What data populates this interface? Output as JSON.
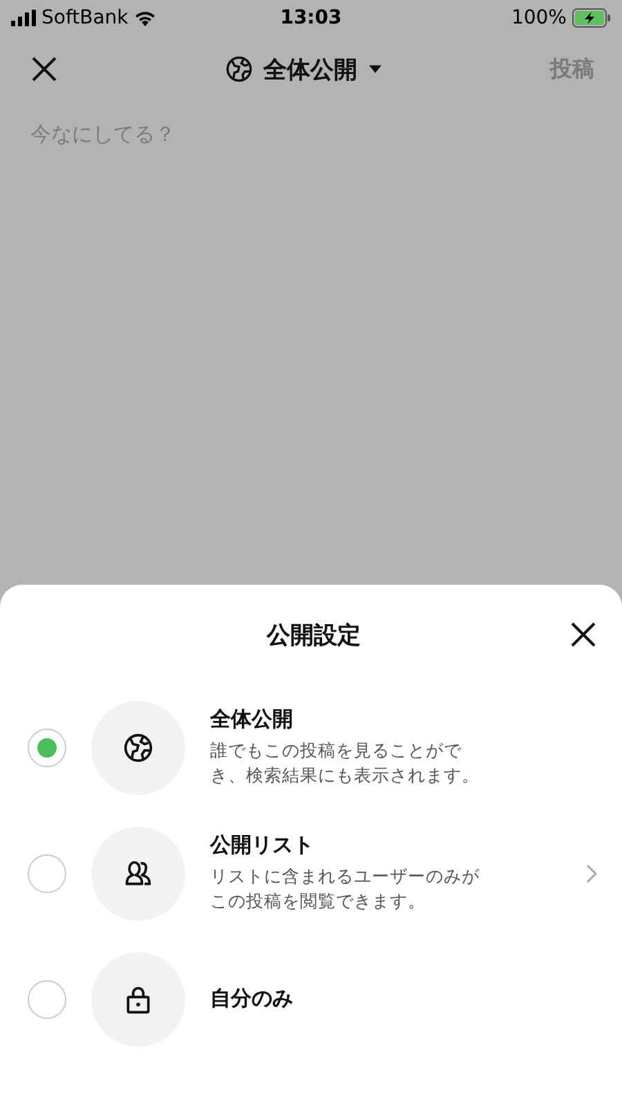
{
  "status_bar": {
    "carrier": "SoftBank",
    "time": "13:03",
    "battery": "100%"
  },
  "header": {
    "audience": "全体公開",
    "post": "投稿",
    "post_disabled": true
  },
  "composer": {
    "placeholder": "今なにしてる？"
  },
  "sheet": {
    "title": "公開設定",
    "options": [
      {
        "kind": "globe",
        "title": "全体公開",
        "description": "誰でもこの投稿を見ることができ、検索結果にも表示されます。",
        "selected": true,
        "chevron": false
      },
      {
        "kind": "people",
        "title": "公開リスト",
        "description": "リストに含まれるユーザーのみがこの投稿を閲覧できます。",
        "selected": false,
        "chevron": true
      },
      {
        "kind": "lock",
        "title": "自分のみ",
        "selected": false,
        "chevron": false
      }
    ]
  }
}
